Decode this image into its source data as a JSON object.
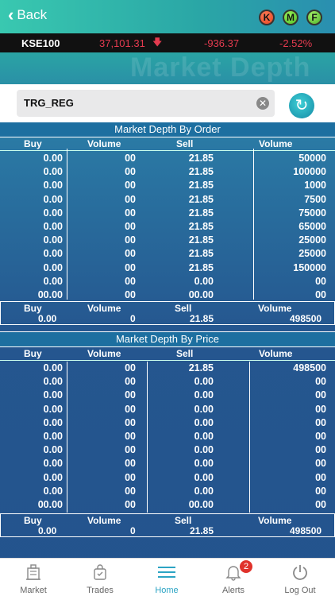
{
  "header": {
    "back_label": "Back",
    "badges": [
      "K",
      "M",
      "F"
    ]
  },
  "ticker": {
    "symbol": "KSE100",
    "value": "37,101.31",
    "change": "-936.37",
    "percent": "-2.52%"
  },
  "page_heading": "Market Depth",
  "search": {
    "value": "TRG_REG"
  },
  "by_order": {
    "title": "Market Depth By Order",
    "headers": [
      "Buy",
      "Volume",
      "Sell",
      "Volume"
    ],
    "rows": [
      [
        "0.00",
        "00",
        "21.85",
        "50000"
      ],
      [
        "0.00",
        "00",
        "21.85",
        "100000"
      ],
      [
        "0.00",
        "00",
        "21.85",
        "1000"
      ],
      [
        "0.00",
        "00",
        "21.85",
        "7500"
      ],
      [
        "0.00",
        "00",
        "21.85",
        "75000"
      ],
      [
        "0.00",
        "00",
        "21.85",
        "65000"
      ],
      [
        "0.00",
        "00",
        "21.85",
        "25000"
      ],
      [
        "0.00",
        "00",
        "21.85",
        "25000"
      ],
      [
        "0.00",
        "00",
        "21.85",
        "150000"
      ],
      [
        "0.00",
        "00",
        "0.00",
        "00"
      ],
      [
        "00.00",
        "00",
        "00.00",
        "00"
      ]
    ],
    "summary": {
      "labels": [
        "Buy",
        "Volume",
        "Sell",
        "Volume"
      ],
      "values": [
        "0.00",
        "0",
        "21.85",
        "498500"
      ]
    }
  },
  "by_price": {
    "title": "Market Depth By Price",
    "headers": [
      "Buy",
      "Volume",
      "Sell",
      "Volume"
    ],
    "rows": [
      [
        "0.00",
        "00",
        "21.85",
        "498500"
      ],
      [
        "0.00",
        "00",
        "0.00",
        "00"
      ],
      [
        "0.00",
        "00",
        "0.00",
        "00"
      ],
      [
        "0.00",
        "00",
        "0.00",
        "00"
      ],
      [
        "0.00",
        "00",
        "0.00",
        "00"
      ],
      [
        "0.00",
        "00",
        "0.00",
        "00"
      ],
      [
        "0.00",
        "00",
        "0.00",
        "00"
      ],
      [
        "0.00",
        "00",
        "0.00",
        "00"
      ],
      [
        "0.00",
        "00",
        "0.00",
        "00"
      ],
      [
        "0.00",
        "00",
        "0.00",
        "00"
      ],
      [
        "00.00",
        "00",
        "00.00",
        "00"
      ]
    ],
    "summary": {
      "labels": [
        "Buy",
        "Volume",
        "Sell",
        "Volume"
      ],
      "values": [
        "0.00",
        "0",
        "21.85",
        "498500"
      ]
    }
  },
  "tabs": [
    {
      "label": "Market",
      "icon": "building-icon"
    },
    {
      "label": "Trades",
      "icon": "shopping-bag-icon"
    },
    {
      "label": "Home",
      "icon": "menu-icon",
      "active": true
    },
    {
      "label": "Alerts",
      "icon": "bell-icon",
      "badge": "2"
    },
    {
      "label": "Log Out",
      "icon": "power-icon"
    }
  ],
  "colors": {
    "accent": "#2ca4c4",
    "negative": "#e43b4f",
    "alert_badge": "#e0322b"
  }
}
